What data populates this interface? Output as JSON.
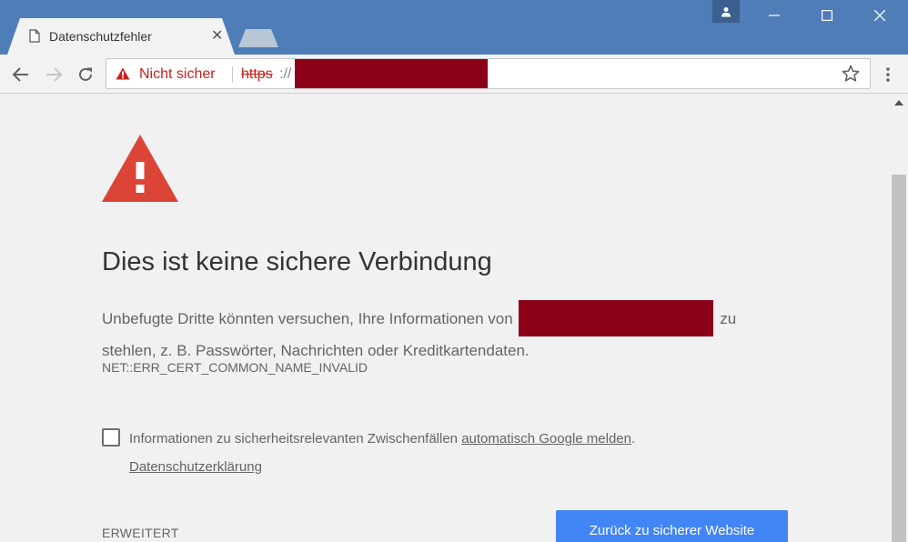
{
  "colors": {
    "accent": "#4285f4",
    "warning": "#db4437",
    "titlebar": "#4f7db8",
    "redaction": "#8b0018"
  },
  "tab": {
    "title": "Datenschutzfehler",
    "close": "✕",
    "icon": "page-icon"
  },
  "omnibox": {
    "security_label": "Nicht sicher",
    "scheme": "https",
    "rest": "://",
    "icon": "warning-icon"
  },
  "page": {
    "heading": "Dies ist keine sichere Verbindung",
    "para_start": "Unbefugte Dritte könnten versuchen, Ihre Informationen von",
    "para_mid": "zu",
    "para_end": "stehlen, z. B. Passwörter, Nachrichten oder Kreditkartendaten.",
    "error_code": "NET::ERR_CERT_COMMON_NAME_INVALID",
    "checkbox_text": "Informationen zu sicherheitsrelevanten Zwischenfällen",
    "checkbox_link": "automatisch Google melden",
    "checkbox_end": ".",
    "privacy_link": "Datenschutzerklärung",
    "advanced": "ERWEITERT",
    "back_button": "Zurück zu sicherer Website"
  }
}
